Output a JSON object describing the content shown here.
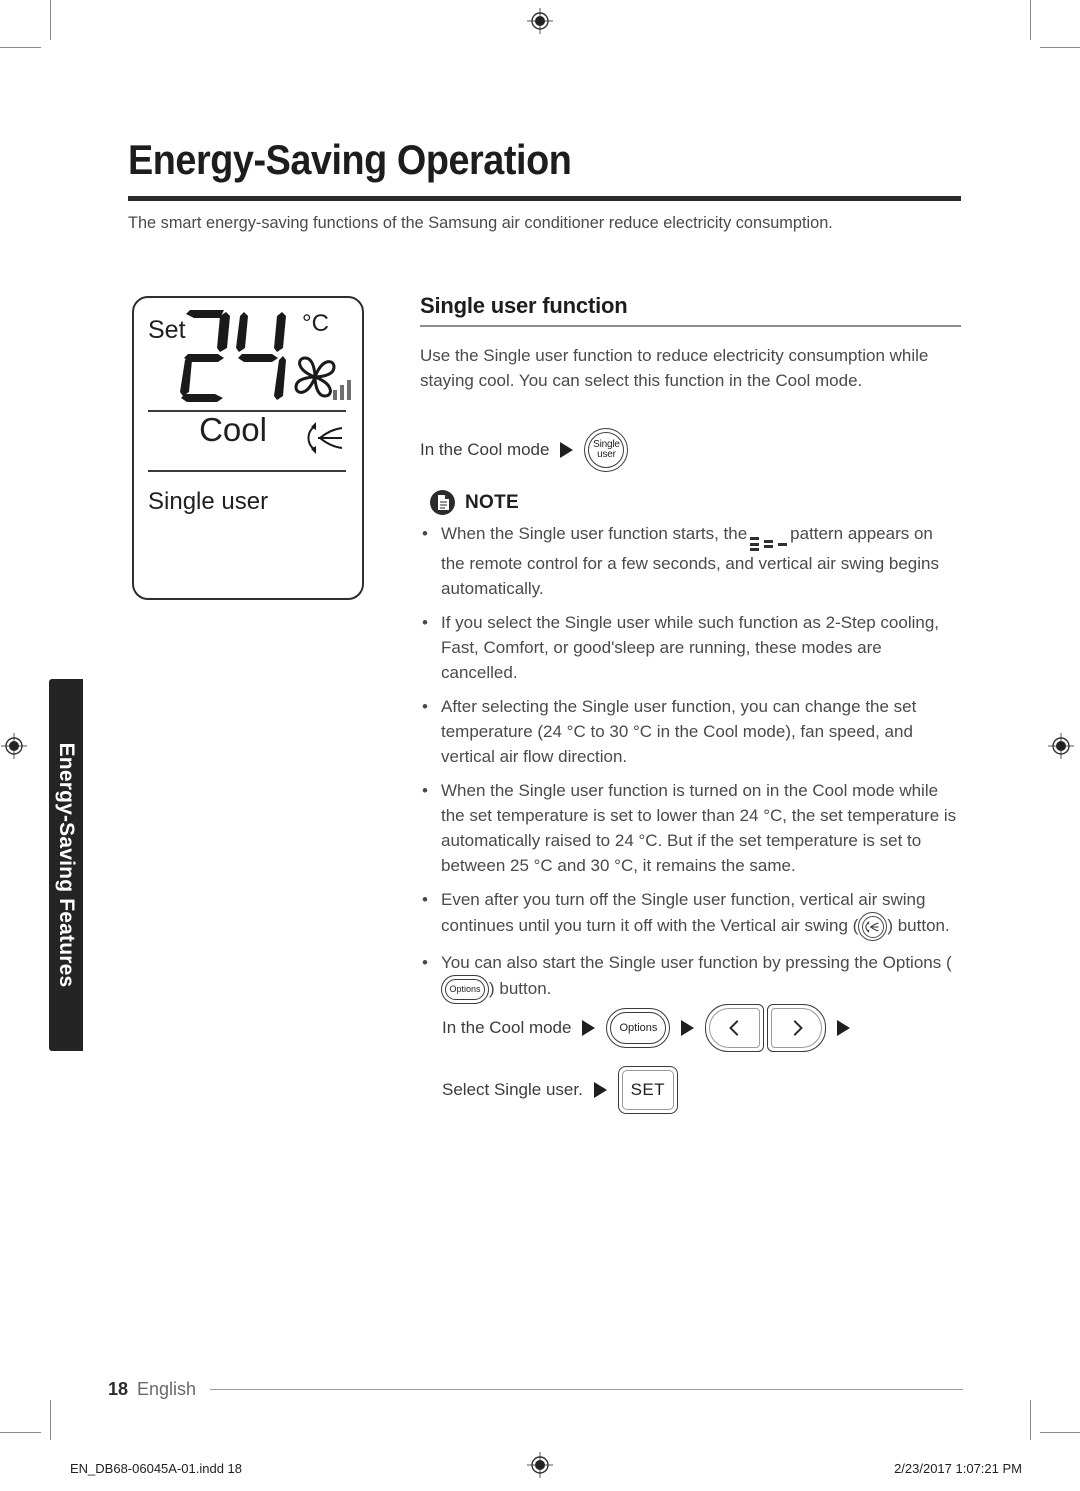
{
  "chapter_tab": {
    "label": "Energy-Saving Features"
  },
  "header": {
    "title": "Energy-Saving Operation",
    "intro": "The smart energy-saving functions of the Samsung air conditioner reduce electricity consumption."
  },
  "lcd_display": {
    "set_label": "Set",
    "temperature": "24",
    "unit": "°C",
    "mode": "Cool",
    "function": "Single user",
    "fan_bars": 3,
    "icons": {
      "fan": "fan-icon",
      "swing": "vertical-swing-icon"
    }
  },
  "section": {
    "heading": "Single user function",
    "body": "Use the Single user function to reduce electricity consumption while staying cool. You can select this function in the Cool mode."
  },
  "flow_top": {
    "prefix": "In the Cool mode",
    "button_line1": "Single",
    "button_line2": "user"
  },
  "note": {
    "label": "NOTE",
    "items": [
      {
        "before": "When the Single user function starts, the",
        "pattern": true,
        "after": "pattern appears on the remote control for a few seconds, and vertical air swing begins automatically."
      },
      {
        "before": "If you select the Single user while such function as 2-Step cooling, Fast, Comfort, or good'sleep are running, these modes are cancelled."
      },
      {
        "before": "After selecting the Single user function, you can change the set temperature (24 °C to 30 °C in the Cool mode), fan speed, and vertical air flow direction."
      },
      {
        "before": "When the Single user function is turned on in the Cool mode while the set temperature is set to lower than 24 °C, the set temperature is automatically raised to 24 °C. But if the set temperature is set to between 25 °C and 30 °C, it remains the same."
      },
      {
        "before": "Even after you turn off the Single user function, vertical air swing continues until you turn it off with the Vertical air swing (",
        "swing_icon": true,
        "after": ") button."
      },
      {
        "before": "You can also start the Single user function by pressing the Options (",
        "options_icon": true,
        "options_label": "Options",
        "after": ") button."
      }
    ]
  },
  "flow_options": {
    "prefix": "In the Cool mode",
    "options_label": "Options",
    "left_arrow": "chevron-left-icon",
    "right_arrow": "chevron-right-icon"
  },
  "flow_set": {
    "prefix": "Select Single user.",
    "set_label": "SET"
  },
  "footer": {
    "page_number": "18",
    "language": "English",
    "imprint_file": "EN_DB68-06045A-01.indd   18",
    "imprint_date": "2/23/2017   1:07:21 PM"
  }
}
